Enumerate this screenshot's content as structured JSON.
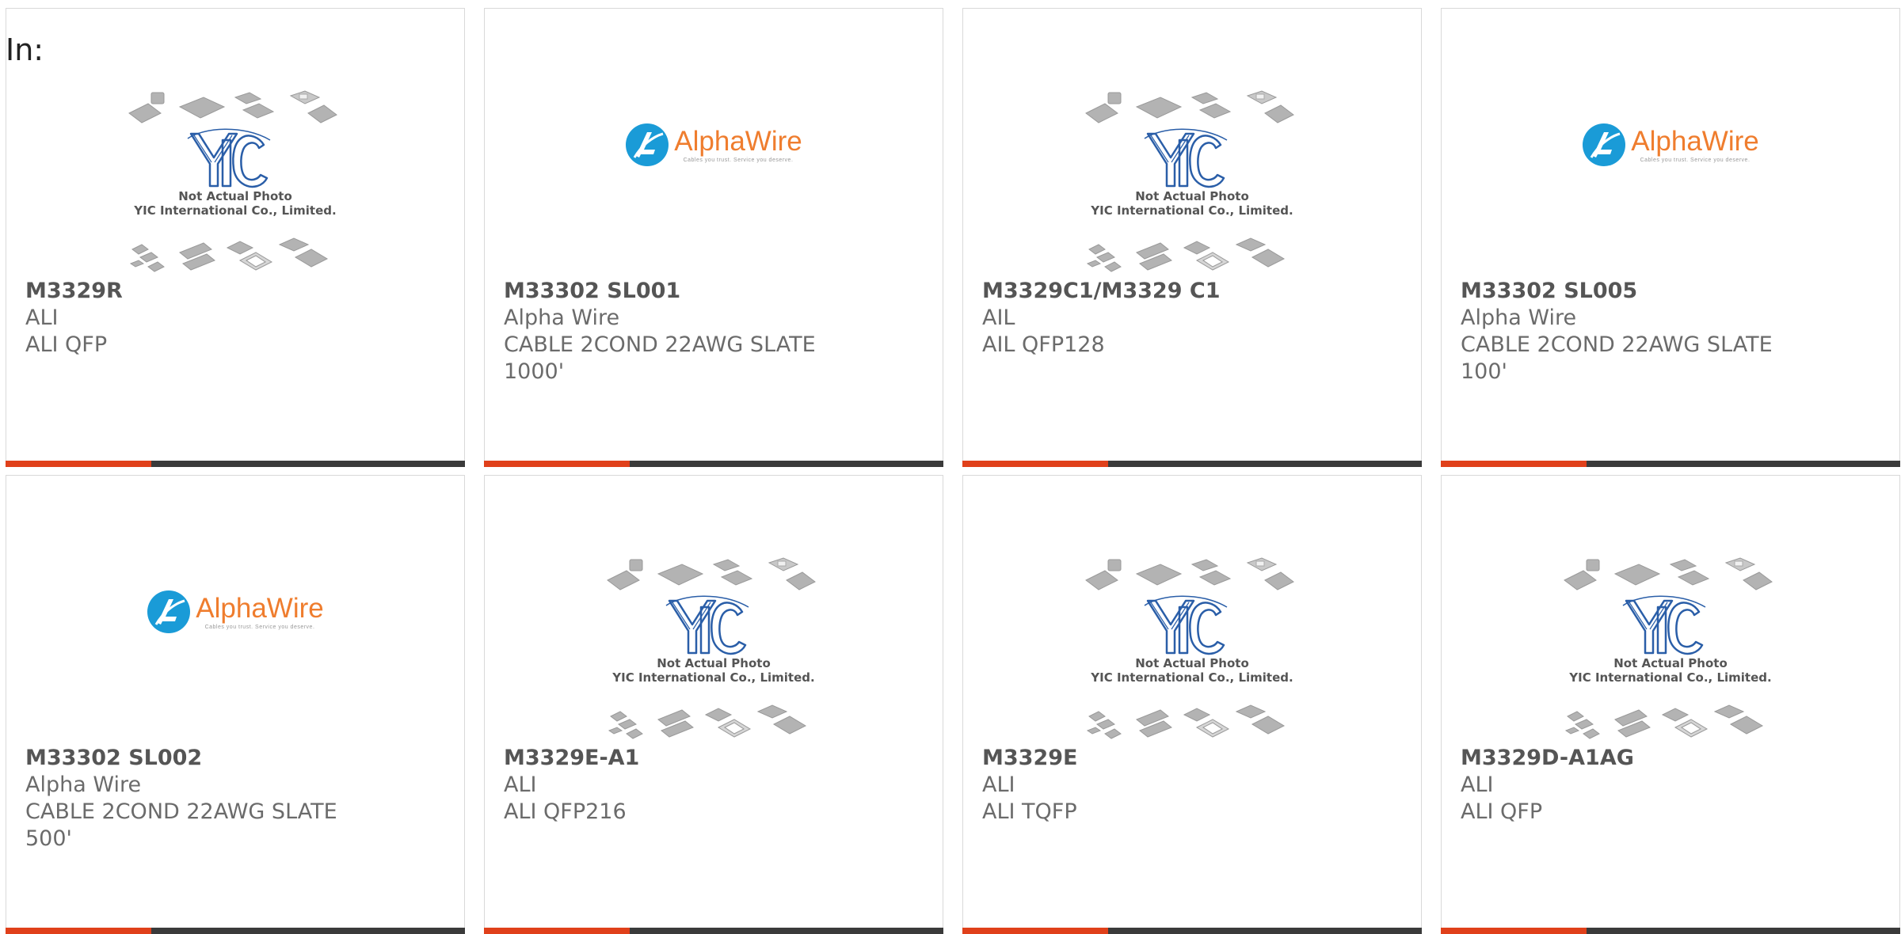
{
  "header": {
    "label": "In:"
  },
  "brand_colors": {
    "accent": "#e0401a",
    "bar": "#3a3a3a",
    "alpha_blue": "#1a9bd7",
    "alpha_orange": "#ef7d2e",
    "yic_blue": "#2a5ea8"
  },
  "placeholders": {
    "yic": {
      "line1": "Not Actual Photo",
      "line2": "YIC International Co., Limited.",
      "logo": "YIC"
    },
    "alpha": {
      "brand": "AlphaWire",
      "tagline": "Cables you trust. Service you deserve."
    }
  },
  "products": [
    {
      "part": "M3329R",
      "maker": "ALI",
      "desc1": "ALI QFP",
      "desc2": "",
      "image": "yic-placeholder"
    },
    {
      "part": "M33302 SL001",
      "maker": "Alpha Wire",
      "desc1": "CABLE 2COND 22AWG SLATE",
      "desc2": "1000'",
      "image": "alphawire-logo"
    },
    {
      "part": "M3329C1/M3329 C1",
      "maker": "AIL",
      "desc1": "AIL QFP128",
      "desc2": "",
      "image": "yic-placeholder"
    },
    {
      "part": "M33302 SL005",
      "maker": "Alpha Wire",
      "desc1": "CABLE 2COND 22AWG SLATE",
      "desc2": "100'",
      "image": "alphawire-logo"
    },
    {
      "part": "M33302 SL002",
      "maker": "Alpha Wire",
      "desc1": "CABLE 2COND 22AWG SLATE",
      "desc2": "500'",
      "image": "alphawire-logo"
    },
    {
      "part": "M3329E-A1",
      "maker": "ALI",
      "desc1": "ALI QFP216",
      "desc2": "",
      "image": "yic-placeholder"
    },
    {
      "part": "M3329E",
      "maker": "ALI",
      "desc1": "ALI TQFP",
      "desc2": "",
      "image": "yic-placeholder"
    },
    {
      "part": "M3329D-A1AG",
      "maker": "ALI",
      "desc1": "ALI QFP",
      "desc2": "",
      "image": "yic-placeholder"
    }
  ]
}
